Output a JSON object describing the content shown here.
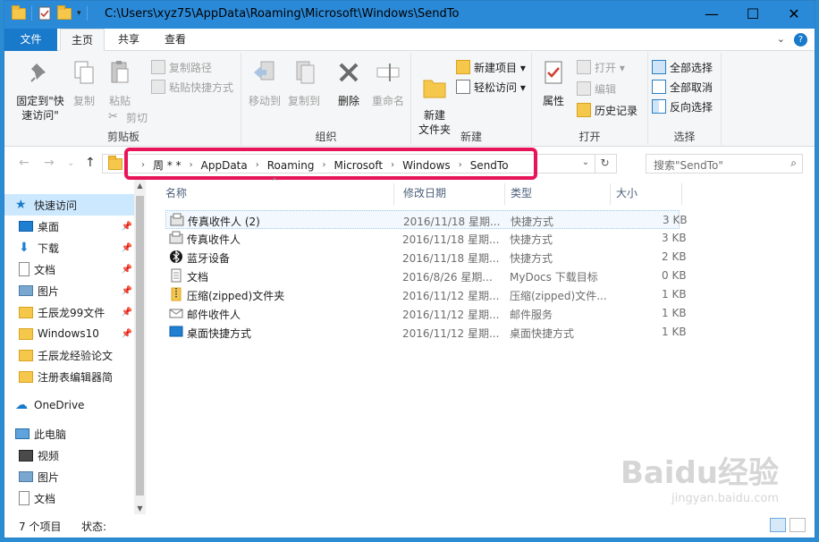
{
  "window": {
    "title": "C:\\Users\\xyz75\\AppData\\Roaming\\Microsoft\\Windows\\SendTo",
    "minimize": "—",
    "maximize": "☐",
    "close": "✕"
  },
  "ribbon_tabs": [
    "文件",
    "主页",
    "共享",
    "查看"
  ],
  "ribbon": {
    "clipboard": {
      "pin_label": "固定到\"快速访问\"",
      "copy": "复制",
      "paste": "粘贴",
      "copy_path": "复制路径",
      "paste_shortcut": "粘贴快捷方式",
      "cut": "剪切",
      "group": "剪贴板"
    },
    "organize": {
      "move_to": "移动到",
      "copy_to": "复制到",
      "delete": "删除",
      "rename": "重命名",
      "group": "组织"
    },
    "new": {
      "new_folder": "新建\n文件夹",
      "new_item": "新建项目 ▾",
      "easy_access": "轻松访问 ▾",
      "group": "新建"
    },
    "open": {
      "properties": "属性",
      "open": "打开 ▾",
      "edit": "编辑",
      "history": "历史记录",
      "group": "打开"
    },
    "select": {
      "select_all": "全部选择",
      "select_none": "全部取消",
      "invert": "反向选择",
      "group": "选择"
    }
  },
  "address": {
    "crumbs": [
      "周 * *",
      "AppData",
      "Roaming",
      "Microsoft",
      "Windows",
      "SendTo"
    ],
    "search_placeholder": "搜索\"SendTo\""
  },
  "nav": {
    "quick_access": "快速访问",
    "items": [
      {
        "label": "桌面",
        "pinned": true
      },
      {
        "label": "下载",
        "pinned": true
      },
      {
        "label": "文档",
        "pinned": true
      },
      {
        "label": "图片",
        "pinned": true
      },
      {
        "label": "壬辰龙99文件",
        "pinned": true
      },
      {
        "label": "Windows10",
        "pinned": true
      },
      {
        "label": "壬辰龙经验论文",
        "pinned": false
      },
      {
        "label": "注册表编辑器简",
        "pinned": false
      }
    ],
    "onedrive": "OneDrive",
    "this_pc": "此电脑",
    "pc_items": [
      "视频",
      "图片",
      "文档"
    ]
  },
  "columns": {
    "name": "名称",
    "date": "修改日期",
    "type": "类型",
    "size": "大小"
  },
  "files": [
    {
      "name": "传真收件人 (2)",
      "date": "2016/11/18 星期...",
      "type": "快捷方式",
      "size": "3 KB",
      "icon": "fax-icon"
    },
    {
      "name": "传真收件人",
      "date": "2016/11/18 星期...",
      "type": "快捷方式",
      "size": "3 KB",
      "icon": "fax-icon"
    },
    {
      "name": "蓝牙设备",
      "date": "2016/11/18 星期...",
      "type": "快捷方式",
      "size": "2 KB",
      "icon": "bluetooth-icon"
    },
    {
      "name": "文档",
      "date": "2016/8/26 星期...",
      "type": "MyDocs 下载目标",
      "size": "0 KB",
      "icon": "document-icon"
    },
    {
      "name": "压缩(zipped)文件夹",
      "date": "2016/11/12 星期...",
      "type": "压缩(zipped)文件...",
      "size": "1 KB",
      "icon": "zip-folder-icon"
    },
    {
      "name": "邮件收件人",
      "date": "2016/11/12 星期...",
      "type": "邮件服务",
      "size": "1 KB",
      "icon": "mail-icon"
    },
    {
      "name": "桌面快捷方式",
      "date": "2016/11/12 星期...",
      "type": "桌面快捷方式",
      "size": "1 KB",
      "icon": "desktop-icon"
    }
  ],
  "status": {
    "count": "7 个项目",
    "state": "状态:"
  },
  "watermark": {
    "line1": "Baidu经验",
    "line2": "jingyan.baidu.com"
  },
  "colors": {
    "titlebar": "#2b8ad8",
    "file_tab": "#1979ca",
    "highlight": "#e8145a",
    "selection": "#cce8ff"
  }
}
